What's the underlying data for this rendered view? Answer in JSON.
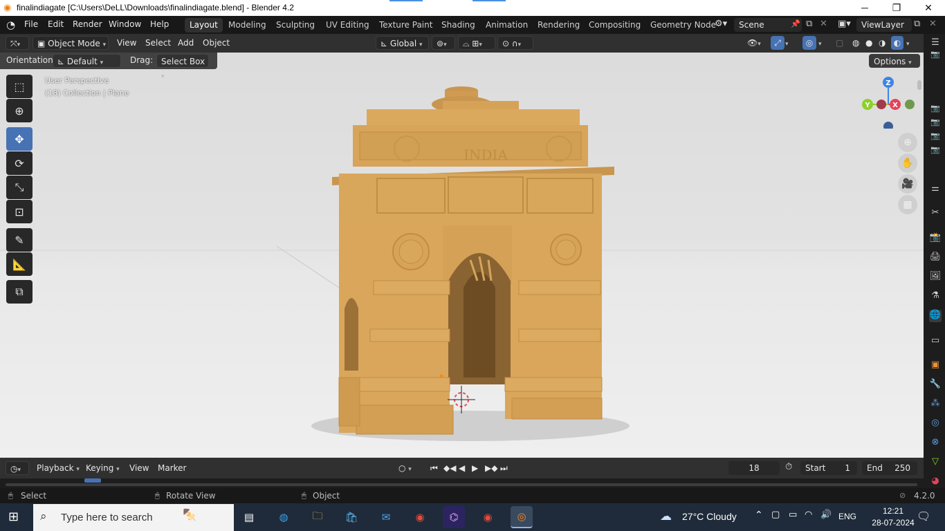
{
  "window": {
    "title": "finalindiagate [C:\\Users\\DeLL\\Downloads\\finalindiagate.blend] - Blender 4.2",
    "minimize": "─",
    "restore": "❐",
    "close": "✕"
  },
  "topbar": {
    "menus": [
      "File",
      "Edit",
      "Render",
      "Window",
      "Help"
    ],
    "workspaces": [
      "Layout",
      "Modeling",
      "Sculpting",
      "UV Editing",
      "Texture Paint",
      "Shading",
      "Animation",
      "Rendering",
      "Compositing",
      "Geometry Node"
    ],
    "active_workspace": "Layout",
    "scene": "Scene",
    "view_layer": "ViewLayer"
  },
  "header": {
    "mode": "Object Mode",
    "menus": [
      "View",
      "Select",
      "Add",
      "Object"
    ],
    "transform_orientation": "Global"
  },
  "tool_header": {
    "orientation_label": "Orientation:",
    "orientation_value": "Default",
    "drag_label": "Drag:",
    "drag_value": "Select Box",
    "options": "Options"
  },
  "viewport": {
    "perspective": "User Perspective",
    "collection_info": "(18) Collection | Plane",
    "inscription": "INDIA",
    "gizmo_axes": [
      "Z",
      "Y",
      "X"
    ]
  },
  "timeline": {
    "menus": [
      "Playback",
      "Keying",
      "View",
      "Marker"
    ],
    "current_frame": "18",
    "start_label": "Start",
    "start_value": "1",
    "end_label": "End",
    "end_value": "250",
    "marker_frame": "18"
  },
  "statusbar": {
    "select": "Select",
    "rotate": "Rotate View",
    "object": "Object",
    "version": "4.2.0"
  },
  "taskbar": {
    "search_placeholder": "Type here to search",
    "weather": "27°C  Cloudy",
    "language": "ENG",
    "time": "12:21",
    "date": "28-07-2024"
  },
  "colors": {
    "accent": "#4772b3",
    "monument": "#d9a55a",
    "axis_x": "#e2445a",
    "axis_y": "#8bd12b",
    "axis_z": "#3d85e6"
  }
}
